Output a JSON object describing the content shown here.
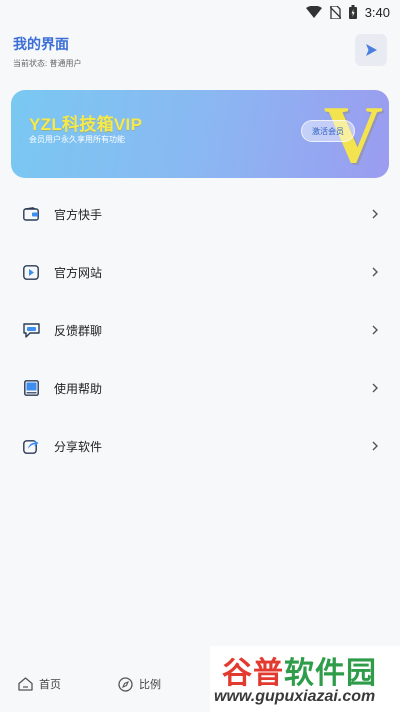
{
  "status_bar": {
    "time": "3:40",
    "icons": [
      "wifi-icon",
      "no-sim-icon",
      "battery-icon"
    ]
  },
  "header": {
    "title": "我的界面",
    "status_label": "当前状态:",
    "status_value": "普通用户",
    "action_icon": "play-icon"
  },
  "vip_banner": {
    "title": "YZL科技箱VIP",
    "subtitle": "会员用户永久享用所有功能",
    "logo_letter": "V",
    "button_label": "激活会员"
  },
  "menu": {
    "items": [
      {
        "label": "官方快手",
        "icon": "wallet-icon"
      },
      {
        "label": "官方网站",
        "icon": "video-play-icon"
      },
      {
        "label": "反馈群聊",
        "icon": "chat-icon"
      },
      {
        "label": "使用帮助",
        "icon": "book-icon"
      },
      {
        "label": "分享软件",
        "icon": "share-icon"
      }
    ]
  },
  "bottom_nav": {
    "items": [
      {
        "label": "首页",
        "icon": "home-icon"
      },
      {
        "label": "比例",
        "icon": "compass-icon"
      }
    ]
  },
  "watermark": {
    "part1": "谷普",
    "part2": "软件园",
    "url": "www.gupuxiazai.com"
  },
  "colors": {
    "accent": "#3b6fd6",
    "vip_gold": "#f6e94a",
    "banner_start": "#79c8f2",
    "banner_end": "#9b9cf0"
  }
}
